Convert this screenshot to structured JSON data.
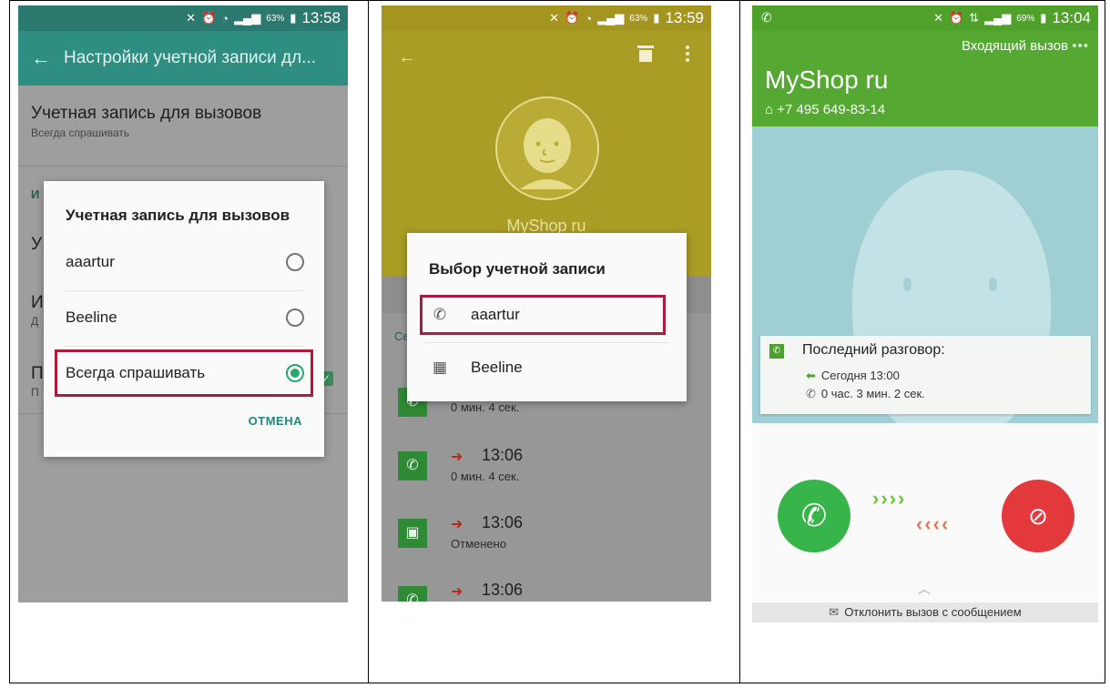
{
  "phone1": {
    "status": {
      "battery": "63%",
      "time": "13:58"
    },
    "appbar": {
      "title": "Настройки учетной записи дл..."
    },
    "setting_calls": {
      "title": "Учетная запись для вызовов",
      "subtitle": "Всегда спрашивать"
    },
    "section_partial": "И",
    "bg_letters": [
      "У",
      "И",
      "Д",
      "П",
      "П"
    ],
    "dialog": {
      "title": "Учетная запись для вызовов",
      "options": [
        {
          "label": "aaartur",
          "selected": false
        },
        {
          "label": "Beeline",
          "selected": false
        },
        {
          "label": "Всегда спрашивать",
          "selected": true
        }
      ],
      "cancel": "ОТМЕНА"
    }
  },
  "phone2": {
    "status": {
      "battery": "63%",
      "time": "13:59"
    },
    "contact_name": "MyShop ru",
    "section_letter": "Се",
    "dialog": {
      "title": "Выбор учетной записи",
      "accounts": [
        {
          "label": "aaartur",
          "icon": "sip-call-icon"
        },
        {
          "label": "Beeline",
          "icon": "sim-card-icon"
        }
      ]
    },
    "log": [
      {
        "time": "",
        "detail": "0 мин. 4 сек."
      },
      {
        "time": "13:06",
        "detail": "0 мин. 4 сек."
      },
      {
        "time": "13:06",
        "detail": "Отменено"
      },
      {
        "time": "13:06",
        "detail": ""
      }
    ]
  },
  "phone3": {
    "status": {
      "battery": "69%",
      "time": "13:04"
    },
    "incoming_label": "Входящий вызов",
    "contact_name": "MyShop ru",
    "phone_number": "+7 495 649-83-14",
    "last_call": {
      "title": "Последний разговор:",
      "when": "Сегодня 13:00",
      "duration": "0 час. 3 мин. 2 сек."
    },
    "reject_message": "Отклонить вызов с сообщением"
  },
  "colors": {
    "teal": "#2e8e82",
    "olive": "#a99d25",
    "green": "#55a832",
    "accept": "#38b54a",
    "reject": "#e4393c",
    "highlight": "#b0183c"
  }
}
